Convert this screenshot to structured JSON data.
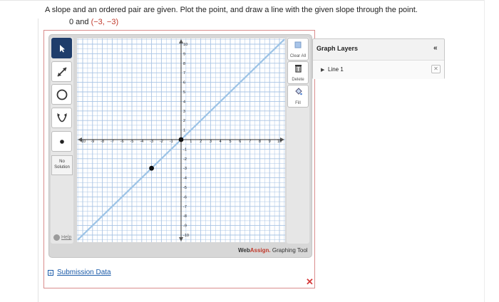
{
  "question": "A slope and an ordered pair are given. Plot the point, and draw a line with the given slope through the point.",
  "given": {
    "slope": "0 and",
    "point": "(−3, −3)"
  },
  "left_tools": [
    {
      "name": "pointer",
      "active": true
    },
    {
      "name": "line"
    },
    {
      "name": "circle"
    },
    {
      "name": "parabola"
    },
    {
      "name": "point"
    }
  ],
  "no_solution_label": "No Solution",
  "help_label": "Help",
  "right_tools": {
    "clear_all": "Clear All",
    "delete": "Delete",
    "fill": "Fill"
  },
  "brand": {
    "web": "Web",
    "assign": "Assign.",
    "tool": " Graphing Tool"
  },
  "graph_layers": {
    "title": "Graph Layers",
    "collapse": "«",
    "items": [
      "Line 1"
    ],
    "delete_symbol": "✕"
  },
  "submission_link": "Submission Data",
  "close_symbol": "✕",
  "graph": {
    "x_range": [
      -10,
      10
    ],
    "y_range": [
      -10,
      10
    ],
    "x_ticks": [
      "-10",
      "-9",
      "-8",
      "-7",
      "-6",
      "-5",
      "-4",
      "-3",
      "-2",
      "-1",
      "1",
      "2",
      "3",
      "4",
      "5",
      "6",
      "7",
      "8",
      "9",
      "10"
    ],
    "y_ticks": [
      "10",
      "9",
      "8",
      "7",
      "6",
      "5",
      "4",
      "3",
      "2",
      "1",
      "-1",
      "-2",
      "-3",
      "-4",
      "-5",
      "-6",
      "-7",
      "-8",
      "-9",
      "-10"
    ],
    "points": [
      {
        "x": -3,
        "y": -3
      },
      {
        "x": 0,
        "y": 0
      }
    ],
    "line": {
      "slope": 1,
      "intercept": 0
    },
    "line_color": "#9cc3e6",
    "grid_color": "#a9c4e4"
  }
}
